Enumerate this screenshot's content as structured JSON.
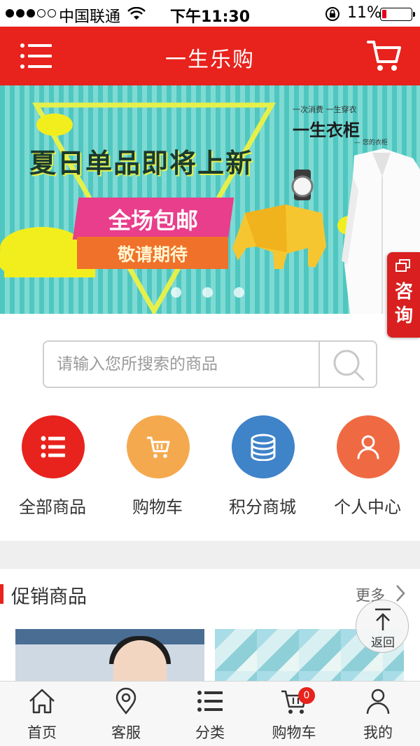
{
  "status_bar": {
    "carrier": "中国联通",
    "time": "下午11:30",
    "battery_percent": "11%",
    "battery_level": 0.11
  },
  "header": {
    "title": "一生乐购",
    "menu_icon": "menu-icon",
    "cart_icon": "cart-icon"
  },
  "banner": {
    "headline": "夏日单品即将上新",
    "badge_main": "全场包邮",
    "badge_sub": "敬请期待",
    "brand_tagline": "一次消费 一生穿衣",
    "brand_name": "一生衣柜",
    "brand_sub": "— 您的衣柜",
    "slides": 3,
    "active_slide": 1
  },
  "consult": {
    "label": "咨询"
  },
  "search": {
    "placeholder": "请输入您所搜索的商品",
    "value": ""
  },
  "quick_nav": [
    {
      "label": "全部商品",
      "icon": "list-icon",
      "color": "#e8221c"
    },
    {
      "label": "购物车",
      "icon": "cart-icon",
      "color": "#f5a94e"
    },
    {
      "label": "积分商城",
      "icon": "coins-icon",
      "color": "#3f83c9"
    },
    {
      "label": "个人中心",
      "icon": "user-icon",
      "color": "#ef6a42"
    }
  ],
  "promo": {
    "title": "促销商品",
    "more": "更多"
  },
  "back_top": {
    "label": "返回"
  },
  "tabbar": [
    {
      "label": "首页",
      "icon": "home-icon"
    },
    {
      "label": "客服",
      "icon": "location-icon"
    },
    {
      "label": "分类",
      "icon": "list-icon"
    },
    {
      "label": "购物车",
      "icon": "cart-icon",
      "badge": "0"
    },
    {
      "label": "我的",
      "icon": "user-icon"
    }
  ],
  "colors": {
    "accent": "#e8221c",
    "banner_teal": "#4fc7c0"
  }
}
